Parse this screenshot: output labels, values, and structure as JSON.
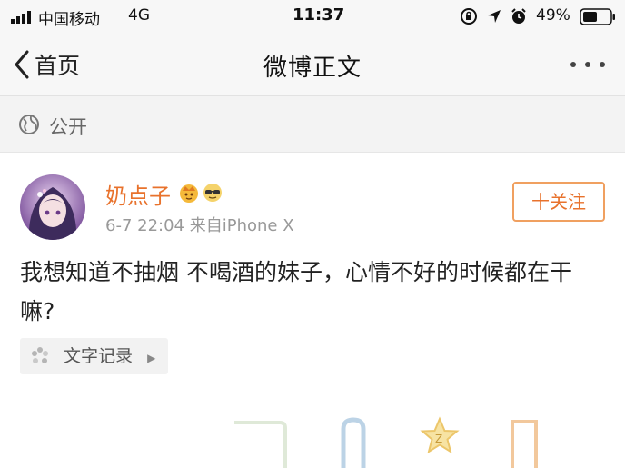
{
  "status_bar": {
    "carrier": "中国移动",
    "network": "4G",
    "time": "11:37",
    "battery_percent": "49%",
    "icons": [
      "signal-icon",
      "rotation-lock-icon",
      "location-icon",
      "alarm-icon",
      "battery-icon"
    ]
  },
  "nav": {
    "back_label": "首页",
    "title": "微博正文",
    "more_icon": "more-dots-icon"
  },
  "visibility": {
    "label": "公开",
    "icon": "globe-icon"
  },
  "post": {
    "author": "奶点子",
    "badges": [
      "crown-badge-icon",
      "sunglasses-badge-icon"
    ],
    "meta": "6-7 22:04  来自iPhone X",
    "follow_label": "十关注",
    "body": "我想知道不抽烟 不喝酒的妹子，心情不好的时候都在干嘛?",
    "topic_tag": "文字记录",
    "accent_color": "#e8722c"
  }
}
